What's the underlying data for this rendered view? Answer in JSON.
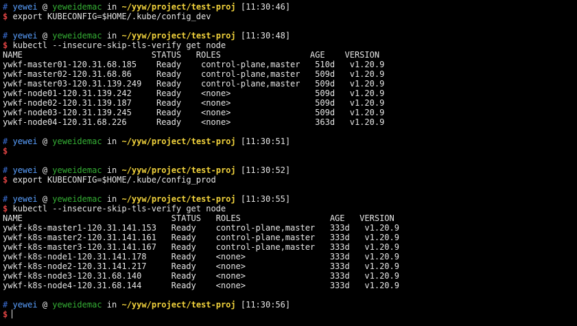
{
  "prompt": {
    "hash": "#",
    "user": "yewei",
    "at": "@",
    "host": "yeweidemac",
    "in": "in",
    "path": "~/yyw/project/test-proj",
    "dollar": "$"
  },
  "blocks": [
    {
      "time": "[11:30:46]",
      "command": "export KUBECONFIG=$HOME/.kube/config_dev",
      "output": []
    },
    {
      "time": "[11:30:48]",
      "command": "kubectl --insecure-skip-tls-verify get node",
      "output": [
        "NAME                          STATUS   ROLES                  AGE    VERSION",
        "ywkf-master01-120.31.68.185    Ready    control-plane,master   510d   v1.20.9",
        "ywkf-master02-120.31.68.86     Ready    control-plane,master   509d   v1.20.9",
        "ywkf-master03-120.31.139.249   Ready    control-plane,master   509d   v1.20.9",
        "ywkf-node01-120.31.139.242     Ready    <none>                 509d   v1.20.9",
        "ywkf-node02-120.31.139.187     Ready    <none>                 509d   v1.20.9",
        "ywkf-node03-120.31.139.245     Ready    <none>                 509d   v1.20.9",
        "ywkf-node04-120.31.68.226      Ready    <none>                 363d   v1.20.9"
      ]
    },
    {
      "time": "[11:30:51]",
      "command": "",
      "output": []
    },
    {
      "time": "[11:30:52]",
      "command": "export KUBECONFIG=$HOME/.kube/config_prod",
      "output": []
    },
    {
      "time": "[11:30:55]",
      "command": "kubectl --insecure-skip-tls-verify get node",
      "output": [
        "NAME                              STATUS   ROLES                  AGE   VERSION",
        "ywkf-k8s-master1-120.31.141.153   Ready    control-plane,master   333d   v1.20.9",
        "ywkf-k8s-master2-120.31.141.161   Ready    control-plane,master   333d   v1.20.9",
        "ywkf-k8s-master3-120.31.141.167   Ready    control-plane,master   333d   v1.20.9",
        "ywkf-k8s-node1-120.31.141.178     Ready    <none>                 333d   v1.20.9",
        "ywkf-k8s-node2-120.31.141.217     Ready    <none>                 333d   v1.20.9",
        "ywkf-k8s-node3-120.31.68.140      Ready    <none>                 333d   v1.20.9",
        "ywkf-k8s-node4-120.31.68.144      Ready    <none>                 333d   v1.20.9"
      ]
    },
    {
      "time": "[11:30:56]",
      "command": "",
      "output": [],
      "cursor": true
    }
  ]
}
